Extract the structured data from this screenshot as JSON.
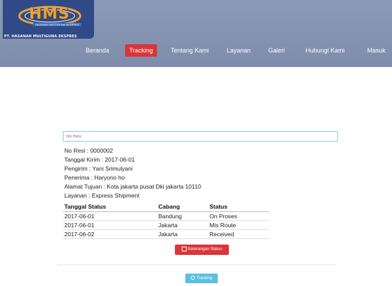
{
  "brand": {
    "logo_text": "HMS",
    "logo_tagline": "HASANAH MULTIGUNA EKSPRES",
    "company_name": "PT. HASANAH MULTIGUNA EKSPRES"
  },
  "nav": {
    "items": [
      {
        "label": "Beranda"
      },
      {
        "label": "Tracking"
      },
      {
        "label": "Tentang Kami"
      },
      {
        "label": "Layanan"
      },
      {
        "label": "Galeri"
      },
      {
        "label": "Hubungi Kami"
      },
      {
        "label": "Masuk"
      }
    ],
    "active": "Tracking"
  },
  "search": {
    "placeholder": "No Resi",
    "value": ""
  },
  "shipment": {
    "no_resi": "No Resi : 0000002",
    "tanggal_kirim": "Tanggal Kirim : 2017-06-01",
    "pengirim": "Pengirim : Yani Srimulyani",
    "penerima": "Penerima : Haryono ho",
    "alamat": "Alamat Tujuan : Kota jakarta pusat Dki jakarta 10110",
    "layanan": "Layanan : Express Shipment"
  },
  "status_table": {
    "headers": [
      "Tanggal Status",
      "Cabang",
      "Status"
    ],
    "rows": [
      [
        "2017-06-01",
        "Bandung",
        "On Proses"
      ],
      [
        "2017-06-01",
        "Jakarta",
        "Mis Route"
      ],
      [
        "2017-06-02",
        "Jakarta",
        "Received"
      ]
    ]
  },
  "buttons": {
    "keterangan": "Keterangan Status",
    "tracking": "Tracking"
  },
  "colors": {
    "header": "#8b9ab5",
    "active_nav": "#d9353a",
    "tracking_button": "#5bc0de",
    "input_border": "#8ed0c8"
  }
}
